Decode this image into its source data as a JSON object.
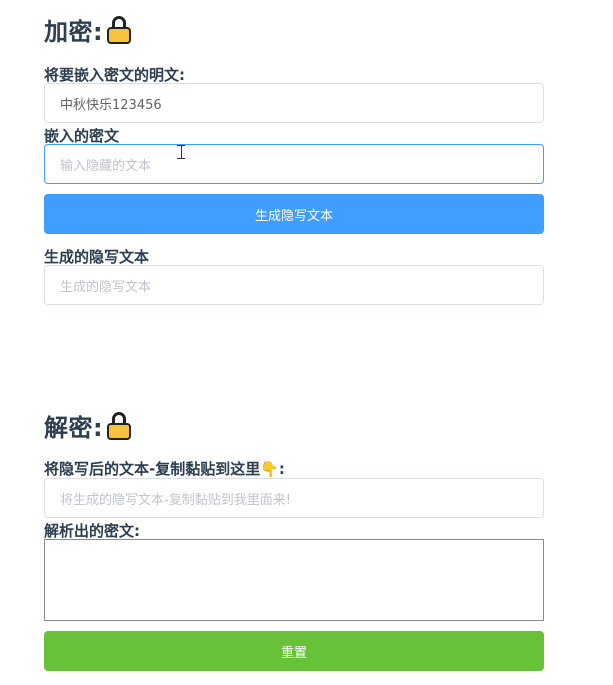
{
  "encrypt": {
    "title": "加密:",
    "plaintext_label": "将要嵌入密文的明文:",
    "plaintext_value": "中秋快乐123456",
    "secret_label": "嵌入的密文",
    "secret_placeholder": "输入隐藏的文本",
    "generate_button": "生成隐写文本",
    "output_label": "生成的隐写文本",
    "output_placeholder": "生成的隐写文本"
  },
  "decrypt": {
    "title": "解密:",
    "paste_label_prefix": "将隐写后的文本-复制黏贴到这里",
    "paste_label_suffix": ":",
    "paste_placeholder": "将生成的隐写文本-复制黏贴到我里面来!",
    "result_label": "解析出的密文:",
    "reset_button": "重置"
  },
  "icons": {
    "lock": "lock-icon",
    "hand": "pointing-down-hand-icon"
  },
  "colors": {
    "primary": "#409eff",
    "success": "#67c23a",
    "lock_body": "#f7c33b",
    "heading": "#2c3e50"
  }
}
